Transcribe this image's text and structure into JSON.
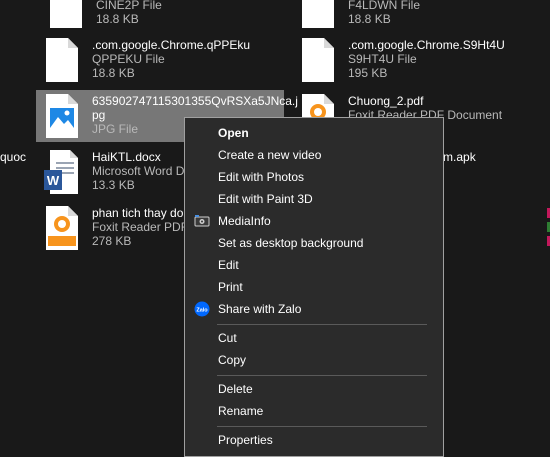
{
  "files": [
    {
      "name": "",
      "type": "CINE2P File",
      "size": "18.8 KB"
    },
    {
      "name": "",
      "type": "F4LDWN File",
      "size": "18.8 KB"
    },
    {
      "name": ".com.google.Chrome.qPPEku",
      "type": "QPPEKU File",
      "size": "18.8 KB"
    },
    {
      "name": ".com.google.Chrome.S9Ht4U",
      "type": "S9HT4U File",
      "size": "195 KB"
    },
    {
      "name": "635902747115301355QvRSXa5JNca.j",
      "name2": "pg",
      "type": "JPG File",
      "size": ""
    },
    {
      "name": "Chuong_2.pdf",
      "type": "Foxit Reader PDF Document",
      "size": ""
    },
    {
      "name": "HaiKTL.docx",
      "type": "Microsoft Word D",
      "size": "13.3 KB"
    },
    {
      "name": "phan tich thay do",
      "type": "Foxit Reader PDF",
      "size": "278 KB"
    }
  ],
  "partial": {
    "left_quoc": "quoc",
    "right_apk": "niem.apk"
  },
  "menu": {
    "items": [
      {
        "label": "Open",
        "icon": "",
        "bold": true
      },
      {
        "label": "Create a new video",
        "icon": ""
      },
      {
        "label": "Edit with Photos",
        "icon": ""
      },
      {
        "label": "Edit with Paint 3D",
        "icon": ""
      },
      {
        "label": "MediaInfo",
        "icon": "mediainfo-icon"
      },
      {
        "label": "Set as desktop background",
        "icon": ""
      },
      {
        "label": "Edit",
        "icon": ""
      },
      {
        "label": "Print",
        "icon": ""
      },
      {
        "label": "Share with Zalo",
        "icon": "zalo-icon"
      },
      {
        "label": "Cut",
        "icon": ""
      },
      {
        "label": "Copy",
        "icon": ""
      },
      {
        "label": "Delete",
        "icon": ""
      },
      {
        "label": "Rename",
        "icon": ""
      },
      {
        "label": "Properties",
        "icon": ""
      }
    ],
    "zalo_icon_text": "Zalo"
  },
  "colors": {
    "background": "#191919",
    "selection": "#777777",
    "menu_bg": "#2b2b2b",
    "foxit_orange": "#f7941d",
    "word_blue": "#2b579a",
    "zalo_blue": "#0068ff"
  }
}
